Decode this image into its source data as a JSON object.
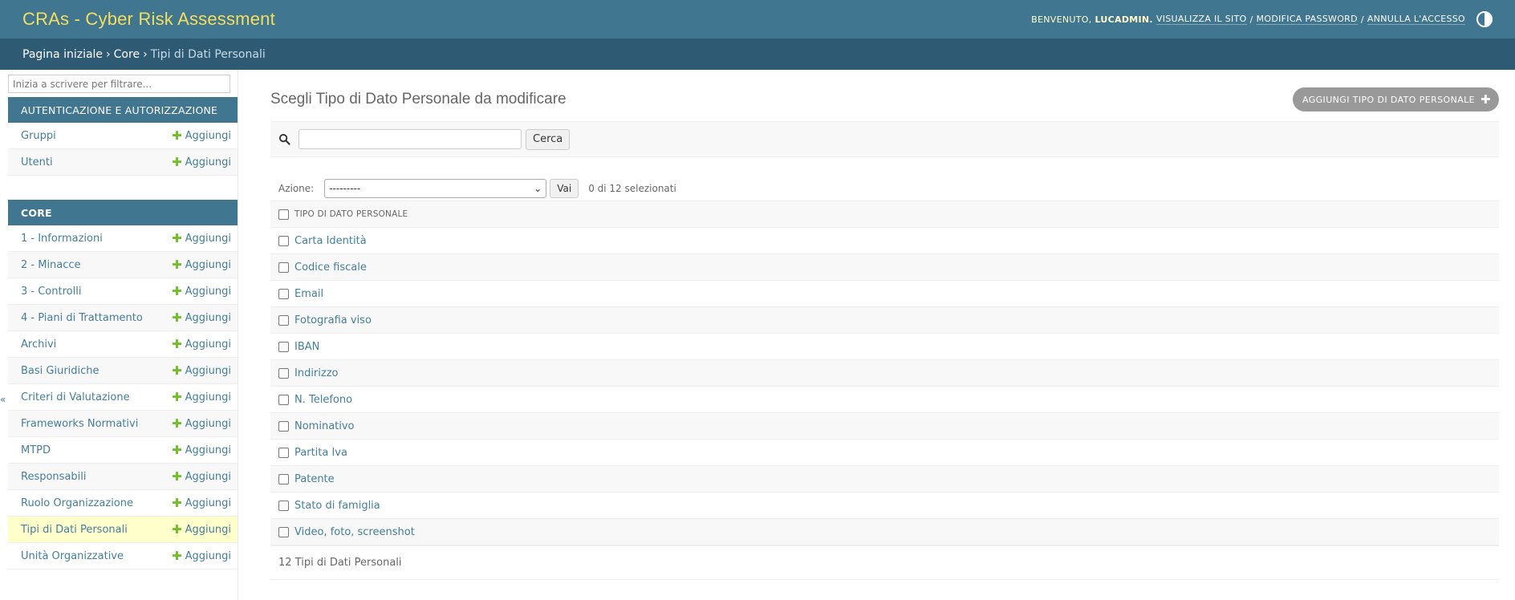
{
  "header": {
    "site_name": "CRAs - Cyber Risk Assessment",
    "welcome": "Benvenuto,",
    "username": "LUCADMIN.",
    "view_site": "Visualizza il sito",
    "change_password": "Modifica password",
    "logout": "Annulla l'accesso",
    "separator": "/"
  },
  "breadcrumbs": {
    "home": "Pagina iniziale",
    "app": "Core",
    "current": "Tipi di Dati Personali",
    "separator": "›"
  },
  "sidebar": {
    "filter_placeholder": "Inizia a scrivere per filtrare...",
    "toggle": "«",
    "add_label": "Aggiungi",
    "auth_caption": "Autenticazione e Autorizzazione",
    "auth_items": [
      {
        "label": "Gruppi"
      },
      {
        "label": "Utenti"
      }
    ],
    "core_caption": "Core",
    "core_items": [
      {
        "label": "1 - Informazioni"
      },
      {
        "label": "2 - Minacce"
      },
      {
        "label": "3 - Controlli"
      },
      {
        "label": "4 - Piani di Trattamento"
      },
      {
        "label": "Archivi"
      },
      {
        "label": "Basi Giuridiche"
      },
      {
        "label": "Criteri di Valutazione"
      },
      {
        "label": "Frameworks Normativi"
      },
      {
        "label": "MTPD"
      },
      {
        "label": "Responsabili"
      },
      {
        "label": "Ruolo Organizzazione"
      },
      {
        "label": "Tipi di Dati Personali",
        "current": true
      },
      {
        "label": "Unità Organizzative"
      }
    ]
  },
  "content": {
    "title": "Scegli Tipo di Dato Personale da modificare",
    "add_button": "Aggiungi Tipo di Dato Personale",
    "search_button": "Cerca",
    "action_label": "Azione:",
    "action_selected": "---------",
    "action_go": "Vai",
    "action_counter": "0 di 12 selezionati",
    "column_header": "Tipo di Dato Personale",
    "rows": [
      "Carta Identità",
      "Codice fiscale",
      "Email",
      "Fotografia viso",
      "IBAN",
      "Indirizzo",
      "N. Telefono",
      "Nominativo",
      "Partita Iva",
      "Patente",
      "Stato di famiglia",
      "Video, foto, screenshot"
    ],
    "paginator": "12 Tipi di Dati Personali"
  },
  "icons": {
    "search": "search-icon",
    "add": "plus-icon",
    "theme": "theme-toggle-icon"
  },
  "colors": {
    "header_bg": "#417690",
    "breadcrumb_bg": "#2f5a73",
    "site_name": "#f5dd5d",
    "link": "#447e9b",
    "add_plus": "#70bf2b",
    "current_row": "#ffffcc"
  }
}
